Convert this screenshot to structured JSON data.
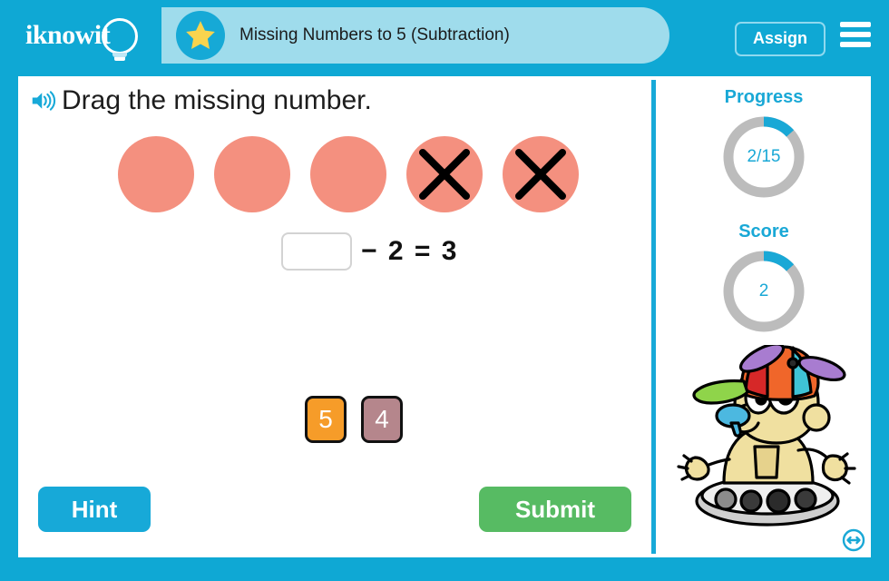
{
  "brand": {
    "logo_text": "iknowit",
    "logo_icon": "lightbulb-icon"
  },
  "header": {
    "title": "Missing Numbers to 5 (Subtraction)",
    "star_icon": "star-icon",
    "assign_label": "Assign",
    "menu_icon": "hamburger-menu-icon",
    "bg_color": "#0fa8d4",
    "pill_color": "#9fdcec"
  },
  "main": {
    "audio_icon": "speaker-icon",
    "prompt": "Drag the missing number.",
    "counters": [
      {
        "crossed": false
      },
      {
        "crossed": false
      },
      {
        "crossed": false
      },
      {
        "crossed": true
      },
      {
        "crossed": true
      }
    ],
    "counter_color": "#f4907f",
    "equation": {
      "blank_value": "",
      "rest": "− 2 = 3",
      "operator": "−",
      "subtrahend": "2",
      "equals": "=",
      "result": "3"
    },
    "tiles": [
      {
        "label": "5",
        "color": "#f69c29"
      },
      {
        "label": "4",
        "color": "#b5868c"
      }
    ],
    "hint_label": "Hint",
    "submit_label": "Submit"
  },
  "sidebar": {
    "progress": {
      "label": "Progress",
      "value": "2/15",
      "completed": 2,
      "total": 15,
      "arc_color": "#19a8d6",
      "track_color": "#bcbcbc"
    },
    "score": {
      "label": "Score",
      "value": "2",
      "completed": 2,
      "total": 15,
      "arc_color": "#19a8d6",
      "track_color": "#bcbcbc"
    },
    "mascot_icon": "robot-mascot-propeller-hat",
    "resize_icon": "resize-horizontal-icon"
  }
}
